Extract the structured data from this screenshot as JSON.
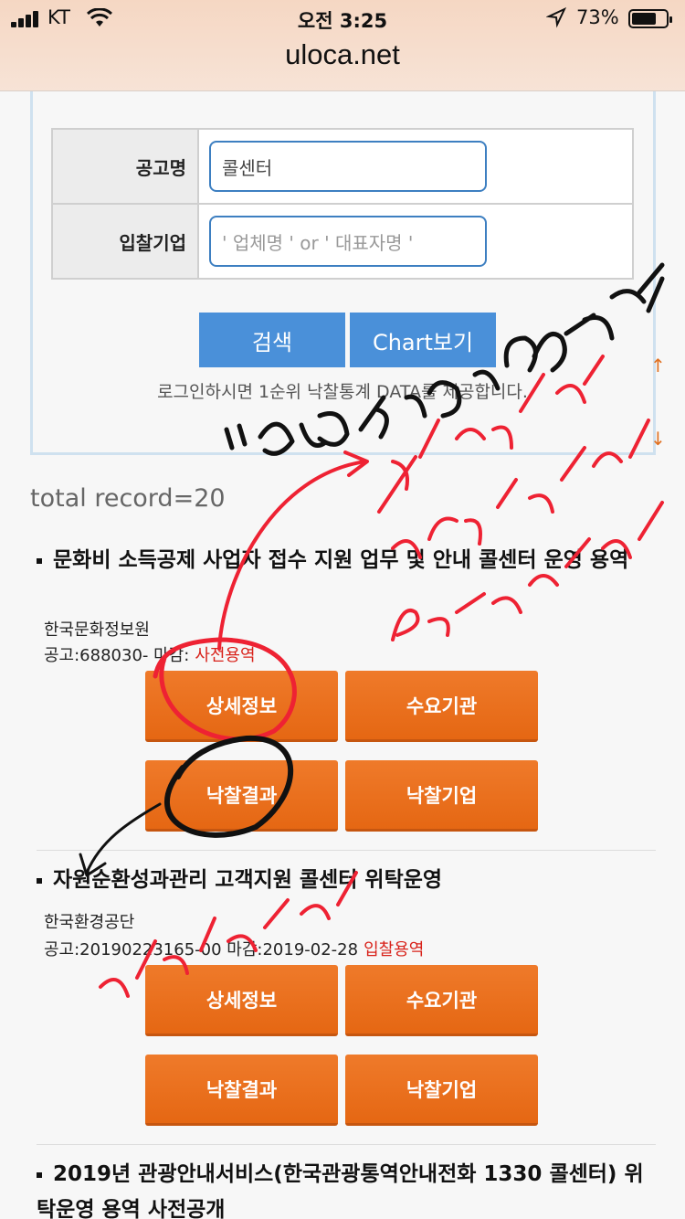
{
  "status_bar": {
    "carrier": "KT",
    "time": "오전 3:25",
    "battery": "73%",
    "battery_level": 0.73
  },
  "browser": {
    "url": "uloca.net"
  },
  "search_form": {
    "notice_name_label": "공고명",
    "notice_name_value": "콜센터",
    "bidder_label": "입찰기업",
    "bidder_placeholder": "' 업체명 ' or ' 대표자명 '",
    "search_button": "검색",
    "chart_button": "Chart보기",
    "login_notice": "로그인하시면 1순위 낙찰통계 DATA를 제공합니다."
  },
  "total_record": "total record=20",
  "records": [
    {
      "title": "문화비 소득공제 사업자 접수 지원 업무 및 안내 콜센터 운영 용역",
      "org": "한국문화정보원",
      "meta": "공고:688030- 마감:",
      "type": "사전용역",
      "buttons": [
        "상세정보",
        "수요기관",
        "낙찰결과",
        "낙찰기업"
      ]
    },
    {
      "title": "자원순환성과관리 고객지원 콜센터 위탁운영",
      "org": "한국환경공단",
      "meta": "공고:20190223165-00 마감:2019-02-28",
      "type": "입찰용역",
      "buttons": [
        "상세정보",
        "수요기관",
        "낙찰결과",
        "낙찰기업"
      ]
    },
    {
      "title": "2019년 관광안내서비스(한국관광통역안내전화 1330 콜센터) 위탁운영 용역 사전공개"
    }
  ],
  "colors": {
    "primary_blue": "#4a90d9",
    "orange_button": "#ea6f1d",
    "type_red": "#d8221a",
    "annotation_red": "#ee2233"
  },
  "side_arrows": [
    "↑",
    "↓"
  ]
}
